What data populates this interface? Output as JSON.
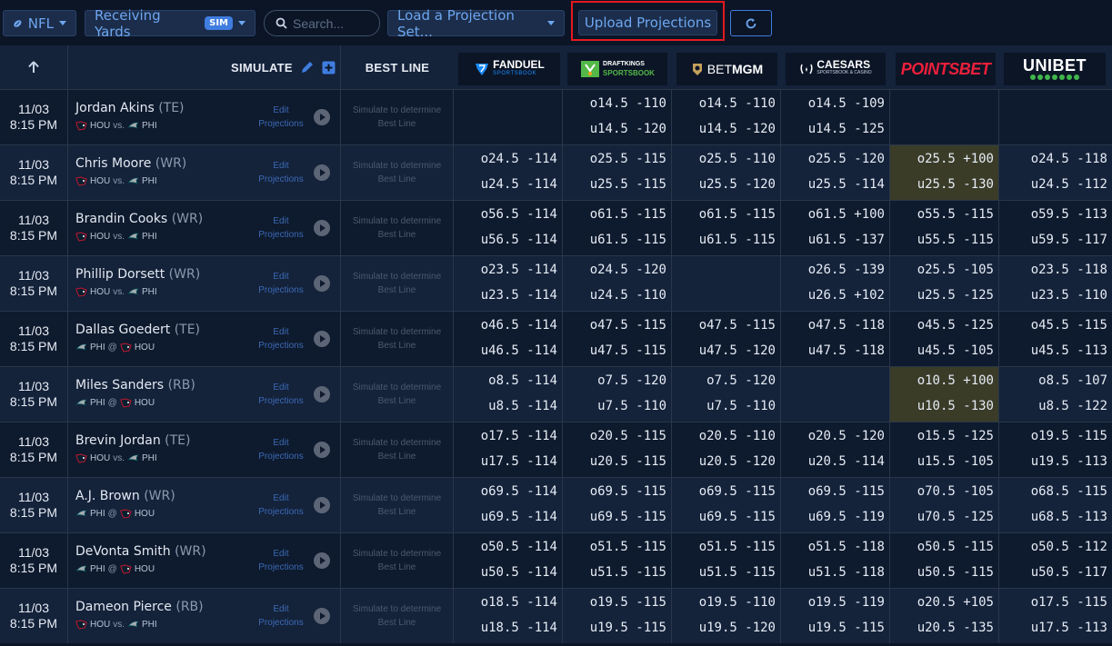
{
  "toolbar": {
    "league": "NFL",
    "market": "Receiving Yards",
    "market_badge": "SIM",
    "search_placeholder": "Search...",
    "projection_set": "Load a Projection Set...",
    "upload": "Upload Projections"
  },
  "header": {
    "simulate": "SIMULATE",
    "best_line": "BEST LINE",
    "books": [
      {
        "name": "FANDUEL",
        "sub": "SPORTSBOOK"
      },
      {
        "name": "DRAFTKINGS",
        "sub": "SPORTSBOOK"
      },
      {
        "name": "BETMGM",
        "prefix": "BET",
        "suffix": "MGM"
      },
      {
        "name": "CAESARS",
        "sub": "SPORTSBOOK & CASINO"
      },
      {
        "name": "POINTSBET"
      },
      {
        "name": "UNIBET"
      }
    ]
  },
  "colors": {
    "background": "#0b1526",
    "accent": "#3f7de0",
    "highlight": "#3a3c28",
    "upload_outline": "#e3191f"
  },
  "rows": [
    {
      "date": "11/03",
      "time": "8:15 PM",
      "name": "Jordan Akins",
      "pos": "(TE)",
      "team1": "HOU",
      "sep": "vs.",
      "team2": "PHI",
      "edit1": "Edit",
      "edit2": "Projections",
      "best1": "Simulate to determine",
      "best2": "Best Line",
      "odds": [
        [
          "",
          ""
        ],
        [
          "o14.5 -110",
          "u14.5 -120"
        ],
        [
          "o14.5 -110",
          "u14.5 -120"
        ],
        [
          "o14.5 -109",
          "u14.5 -125"
        ],
        [
          "",
          ""
        ],
        [
          "",
          ""
        ]
      ],
      "hl": []
    },
    {
      "date": "11/03",
      "time": "8:15 PM",
      "name": "Chris Moore",
      "pos": "(WR)",
      "team1": "HOU",
      "sep": "vs.",
      "team2": "PHI",
      "edit1": "Edit",
      "edit2": "Projections",
      "best1": "Simulate to determine",
      "best2": "Best Line",
      "odds": [
        [
          "o24.5 -114",
          "u24.5 -114"
        ],
        [
          "o25.5 -115",
          "u25.5 -115"
        ],
        [
          "o25.5 -110",
          "u25.5 -120"
        ],
        [
          "o25.5 -120",
          "u25.5 -114"
        ],
        [
          "o25.5 +100",
          "u25.5 -130"
        ],
        [
          "o24.5 -118",
          "u24.5 -112"
        ]
      ],
      "hl": [
        4
      ]
    },
    {
      "date": "11/03",
      "time": "8:15 PM",
      "name": "Brandin Cooks",
      "pos": "(WR)",
      "team1": "HOU",
      "sep": "vs.",
      "team2": "PHI",
      "edit1": "Edit",
      "edit2": "Projections",
      "best1": "Simulate to determine",
      "best2": "Best Line",
      "odds": [
        [
          "o56.5 -114",
          "u56.5 -114"
        ],
        [
          "o61.5 -115",
          "u61.5 -115"
        ],
        [
          "o61.5 -115",
          "u61.5 -115"
        ],
        [
          "o61.5 +100",
          "u61.5 -137"
        ],
        [
          "o55.5 -115",
          "u55.5 -115"
        ],
        [
          "o59.5 -113",
          "u59.5 -117"
        ]
      ],
      "hl": []
    },
    {
      "date": "11/03",
      "time": "8:15 PM",
      "name": "Phillip Dorsett",
      "pos": "(WR)",
      "team1": "HOU",
      "sep": "vs.",
      "team2": "PHI",
      "edit1": "Edit",
      "edit2": "Projections",
      "best1": "Simulate to determine",
      "best2": "Best Line",
      "odds": [
        [
          "o23.5 -114",
          "u23.5 -114"
        ],
        [
          "o24.5 -120",
          "u24.5 -110"
        ],
        [
          "",
          ""
        ],
        [
          "o26.5 -139",
          "u26.5 +102"
        ],
        [
          "o25.5 -105",
          "u25.5 -125"
        ],
        [
          "o23.5 -118",
          "u23.5 -110"
        ]
      ],
      "hl": []
    },
    {
      "date": "11/03",
      "time": "8:15 PM",
      "name": "Dallas Goedert",
      "pos": "(TE)",
      "team1": "PHI",
      "sep": "@",
      "team2": "HOU",
      "edit1": "Edit",
      "edit2": "Projections",
      "best1": "Simulate to determine",
      "best2": "Best Line",
      "odds": [
        [
          "o46.5 -114",
          "u46.5 -114"
        ],
        [
          "o47.5 -115",
          "u47.5 -115"
        ],
        [
          "o47.5 -115",
          "u47.5 -120"
        ],
        [
          "o47.5 -118",
          "u47.5 -118"
        ],
        [
          "o45.5 -125",
          "u45.5 -105"
        ],
        [
          "o45.5 -115",
          "u45.5 -113"
        ]
      ],
      "hl": []
    },
    {
      "date": "11/03",
      "time": "8:15 PM",
      "name": "Miles Sanders",
      "pos": "(RB)",
      "team1": "PHI",
      "sep": "@",
      "team2": "HOU",
      "edit1": "Edit",
      "edit2": "Projections",
      "best1": "Simulate to determine",
      "best2": "Best Line",
      "odds": [
        [
          "o8.5 -114",
          "u8.5 -114"
        ],
        [
          "o7.5 -120",
          "u7.5 -110"
        ],
        [
          "o7.5 -120",
          "u7.5 -110"
        ],
        [
          "",
          ""
        ],
        [
          "o10.5 +100",
          "u10.5 -130"
        ],
        [
          "o8.5 -107",
          "u8.5 -122"
        ]
      ],
      "hl": [
        4
      ]
    },
    {
      "date": "11/03",
      "time": "8:15 PM",
      "name": "Brevin Jordan",
      "pos": "(TE)",
      "team1": "HOU",
      "sep": "vs.",
      "team2": "PHI",
      "edit1": "Edit",
      "edit2": "Projections",
      "best1": "Simulate to determine",
      "best2": "Best Line",
      "odds": [
        [
          "o17.5 -114",
          "u17.5 -114"
        ],
        [
          "o20.5 -115",
          "u20.5 -115"
        ],
        [
          "o20.5 -110",
          "u20.5 -120"
        ],
        [
          "o20.5 -120",
          "u20.5 -114"
        ],
        [
          "o15.5 -125",
          "u15.5 -105"
        ],
        [
          "o19.5 -115",
          "u19.5 -113"
        ]
      ],
      "hl": []
    },
    {
      "date": "11/03",
      "time": "8:15 PM",
      "name": "A.J. Brown",
      "pos": "(WR)",
      "team1": "PHI",
      "sep": "@",
      "team2": "HOU",
      "edit1": "Edit",
      "edit2": "Projections",
      "best1": "Simulate to determine",
      "best2": "Best Line",
      "odds": [
        [
          "o69.5 -114",
          "u69.5 -114"
        ],
        [
          "o69.5 -115",
          "u69.5 -115"
        ],
        [
          "o69.5 -115",
          "u69.5 -115"
        ],
        [
          "o69.5 -115",
          "u69.5 -119"
        ],
        [
          "o70.5 -105",
          "u70.5 -125"
        ],
        [
          "o68.5 -115",
          "u68.5 -113"
        ]
      ],
      "hl": []
    },
    {
      "date": "11/03",
      "time": "8:15 PM",
      "name": "DeVonta Smith",
      "pos": "(WR)",
      "team1": "PHI",
      "sep": "@",
      "team2": "HOU",
      "edit1": "Edit",
      "edit2": "Projections",
      "best1": "Simulate to determine",
      "best2": "Best Line",
      "odds": [
        [
          "o50.5 -114",
          "u50.5 -114"
        ],
        [
          "o51.5 -115",
          "u51.5 -115"
        ],
        [
          "o51.5 -115",
          "u51.5 -115"
        ],
        [
          "o51.5 -118",
          "u51.5 -118"
        ],
        [
          "o50.5 -115",
          "u50.5 -115"
        ],
        [
          "o50.5 -112",
          "u50.5 -117"
        ]
      ],
      "hl": []
    },
    {
      "date": "11/03",
      "time": "8:15 PM",
      "name": "Dameon Pierce",
      "pos": "(RB)",
      "team1": "HOU",
      "sep": "vs.",
      "team2": "PHI",
      "edit1": "Edit",
      "edit2": "Projections",
      "best1": "Simulate to determine",
      "best2": "Best Line",
      "odds": [
        [
          "o18.5 -114",
          "u18.5 -114"
        ],
        [
          "o19.5 -115",
          "u19.5 -115"
        ],
        [
          "o19.5 -110",
          "u19.5 -120"
        ],
        [
          "o19.5 -119",
          "u19.5 -115"
        ],
        [
          "o20.5 +105",
          "u20.5 -135"
        ],
        [
          "o17.5 -115",
          "u17.5 -113"
        ]
      ],
      "hl": []
    }
  ]
}
